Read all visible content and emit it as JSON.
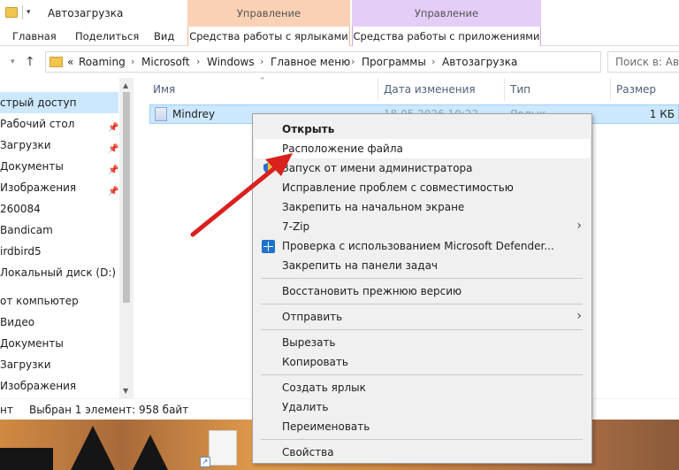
{
  "window": {
    "title": "Автозагрузка",
    "quick_access_drop": "▾"
  },
  "ribbon": {
    "context_headers": [
      "Управление",
      "Управление"
    ],
    "tabs": [
      "Главная",
      "Поделиться",
      "Вид"
    ],
    "context_tabs": [
      "Средства работы с ярлыками",
      "Средства работы с приложениями"
    ]
  },
  "address": {
    "prefix": "«",
    "crumbs": [
      "Roaming",
      "Microsoft",
      "Windows",
      "Главное меню",
      "Программы",
      "Автозагрузка"
    ],
    "search_placeholder": "Поиск в: Авто"
  },
  "navpane": {
    "items": [
      {
        "label": "стрый доступ",
        "pinned": false
      },
      {
        "label": "Рабочий стол",
        "pinned": true
      },
      {
        "label": "Загрузки",
        "pinned": true
      },
      {
        "label": "Документы",
        "pinned": true
      },
      {
        "label": "Изображения",
        "pinned": true
      },
      {
        "label": "260084",
        "pinned": false
      },
      {
        "label": "Bandicam",
        "pinned": false
      },
      {
        "label": "irdbird5",
        "pinned": false
      },
      {
        "label": "Локальный диск (D:)",
        "pinned": false
      },
      {
        "label": "от компьютер",
        "pinned": false
      },
      {
        "label": "Видео",
        "pinned": false
      },
      {
        "label": "Документы",
        "pinned": false
      },
      {
        "label": "Загрузки",
        "pinned": false
      },
      {
        "label": "Изображения",
        "pinned": false
      }
    ]
  },
  "filelist": {
    "columns": [
      "Имя",
      "Дата изменения",
      "Тип",
      "Размер"
    ],
    "file": {
      "name": "Mindrey",
      "date": "18.05.2026 10:22",
      "type": "Ярлык",
      "size": "1 КБ"
    }
  },
  "status": {
    "count": "нт",
    "selection": "Выбран 1 элемент: 958 байт"
  },
  "context_menu": {
    "items": [
      {
        "label": "Открыть",
        "bold": true
      },
      {
        "label": "Расположение файла",
        "hover": true
      },
      {
        "label": "Запуск от имени администратора",
        "icon": "uac-shield-icon"
      },
      {
        "label": "Исправление проблем с совместимостью"
      },
      {
        "label": "Закрепить на начальном экране"
      },
      {
        "label": "7-Zip",
        "submenu": true
      },
      {
        "label": "Проверка с использованием Microsoft Defender...",
        "icon": "defender-icon"
      },
      {
        "label": "Закрепить на панели задач"
      },
      {
        "label": "Восстановить прежнюю версию"
      },
      {
        "label": "Отправить",
        "submenu": true
      },
      {
        "label": "Вырезать"
      },
      {
        "label": "Копировать"
      },
      {
        "label": "Создать ярлык"
      },
      {
        "label": "Удалить"
      },
      {
        "label": "Переименовать"
      },
      {
        "label": "Свойства"
      }
    ],
    "submenu_glyph": "›"
  },
  "colors": {
    "selection": "#cce8ff",
    "annotation_arrow": "#d9211d"
  }
}
